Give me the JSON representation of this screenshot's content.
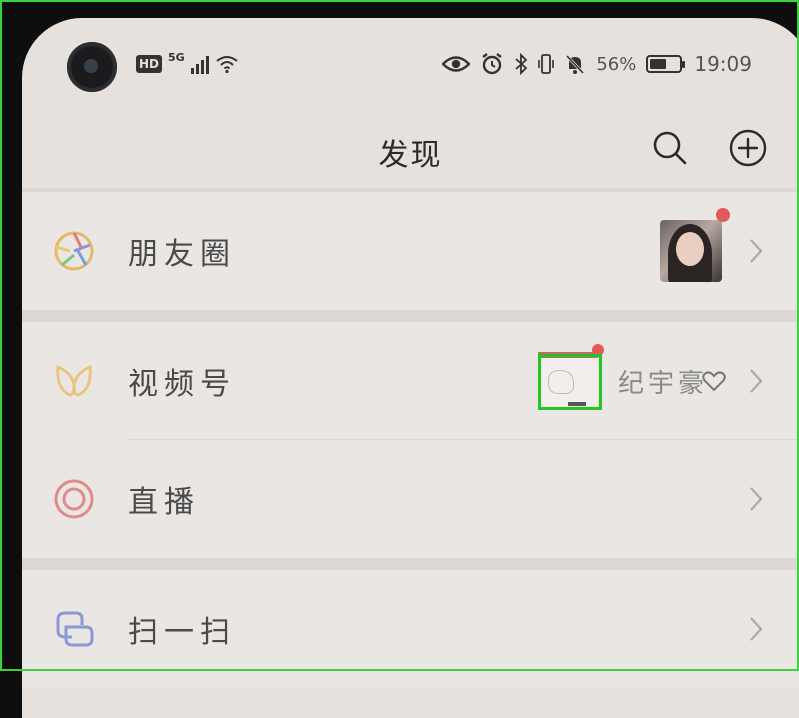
{
  "status_bar": {
    "hd_badge": "HD",
    "network": "5G",
    "battery_percent": "56%",
    "battery_level": 0.56,
    "time": "19:09",
    "icons": [
      "eye-icon",
      "alarm-icon",
      "bluetooth-icon",
      "vibrate-icon",
      "mute-bell-icon",
      "battery-icon"
    ]
  },
  "header": {
    "title": "发现",
    "search_icon": "search-icon",
    "add_icon": "plus-circle-icon"
  },
  "items": [
    {
      "label": "朋友圈",
      "icon": "moments-aperture-icon",
      "has_thumbnail": true,
      "has_red_dot": true
    },
    {
      "label": "视频号",
      "icon": "channels-butterfly-icon",
      "has_thumbnail": true,
      "has_red_dot": true,
      "extra_text": "纪宇豪",
      "extra_icon": "heart-icon"
    },
    {
      "label": "直播",
      "icon": "live-target-icon"
    },
    {
      "label": "扫一扫",
      "icon": "scan-icon"
    }
  ],
  "colors": {
    "background": "#e7e1dd",
    "red_dot": "#e05a5a",
    "highlight": "#22c522"
  }
}
